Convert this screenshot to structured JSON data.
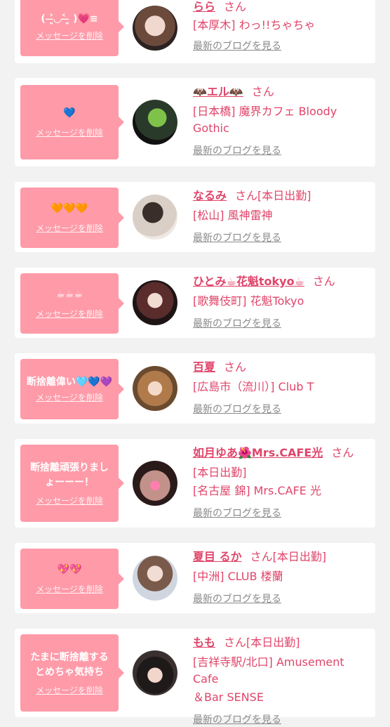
{
  "delete_label": "メッセージを削除",
  "blog_label": "最新のブログを見る",
  "san": "さん",
  "colors": {
    "accent": "#e0456a",
    "msg_bg": "#ff9aa8",
    "page_bg": "#f2f2f2"
  },
  "cards": [
    {
      "msg": "( ˃̶͈◡˂ ̶͈ )💗≡",
      "name": "らら",
      "status": "",
      "shop": [
        "[本厚木] わっ!!ちゃちゃ"
      ]
    },
    {
      "msg": "💙",
      "name": "🦇エル🦇",
      "status": "",
      "shop": [
        "[日本橋] 魔界カフェ Bloody",
        "Gothic"
      ]
    },
    {
      "msg": "🧡🧡🧡",
      "name": "なるみ",
      "status": "[本日出勤]",
      "shop": [
        "[松山] 風神雷神"
      ]
    },
    {
      "msg": "☕☕☕",
      "name": "ひとみ☕花魁tokyo☕",
      "status": "",
      "shop": [
        "[歌舞伎町] 花魁Tokyo"
      ]
    },
    {
      "msg": "断捨離偉い🩵💙💜",
      "name": "百夏",
      "status": "",
      "shop": [
        "[広島市（流川）] Club T"
      ]
    },
    {
      "msg": "断捨離頑張りましょーーー！",
      "name": "如月ゆあ🌺Mrs.CAFE光",
      "status": "",
      "shop": [
        "[本日出勤]",
        "[名古屋 錦] Mrs.CAFE 光"
      ]
    },
    {
      "msg": "💖💖",
      "name": "夏目 るか",
      "status": "[本日出勤]",
      "shop": [
        "[中洲] CLUB 楼蘭"
      ]
    },
    {
      "msg": "たまに断捨離するとめちゃ気持ち",
      "name": "もも",
      "status": "[本日出勤]",
      "shop": [
        "[吉祥寺駅/北口] Amusement Cafe",
        "＆Bar SENSE"
      ]
    }
  ]
}
